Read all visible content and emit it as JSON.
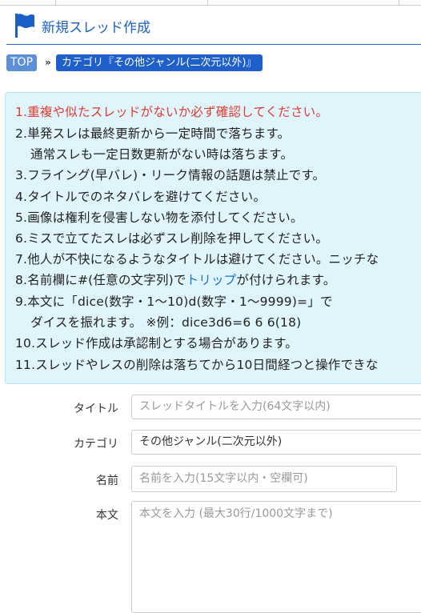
{
  "page": {
    "title": "新規スレッド作成"
  },
  "breadcrumb": {
    "top": "TOP",
    "separator": "»",
    "category": "カテゴリ『その他ジャンル(二次元以外)』"
  },
  "notice": {
    "line1": "1.重複や似たスレッドがないか必ず確認してください。",
    "line2": "2.単発スレは最終更新から一定時間で落ちます。",
    "line2b": "通常スレも一定日数更新がない時は落ちます。",
    "line3": "3.フライング(早バレ)・リーク情報の話題は禁止です。",
    "line4": "4.タイトルでのネタバレを避けてください。",
    "line5": "5.画像は権利を侵害しない物を添付してください。",
    "line6": "6.ミスで立てたスレは必ずスレ削除を押してください。",
    "line7": "7.他人が不快になるようなタイトルは避けてください。ニッチな",
    "line8_pre": "8.名前欄に#(任意の文字列)で",
    "line8_link": "トリップ",
    "line8_post": "が付けられます。",
    "line9": "9.本文に「dice(数字・1〜10)d(数字・1〜9999)=」で",
    "line9b": "ダイスを振れます。 ※例：dice3d6=6 6 6(18)",
    "line10": "10.スレッド作成は承認制とする場合があります。",
    "line11": "11.スレッドやレスの削除は落ちてから10日間経つと操作できな"
  },
  "form": {
    "title_label": "タイトル",
    "title_placeholder": "スレッドタイトルを入力(64文字以内)",
    "category_label": "カテゴリ",
    "category_value": "その他ジャンル(二次元以外)",
    "name_label": "名前",
    "name_placeholder": "名前を入力(15文字以内・空欄可)",
    "body_label": "本文",
    "body_placeholder": "本文を入力 (最大30行/1000文字まで)"
  },
  "colors": {
    "accent": "#1a5fc8",
    "notice_bg": "#dff5fb",
    "warning": "#e03a2f"
  }
}
